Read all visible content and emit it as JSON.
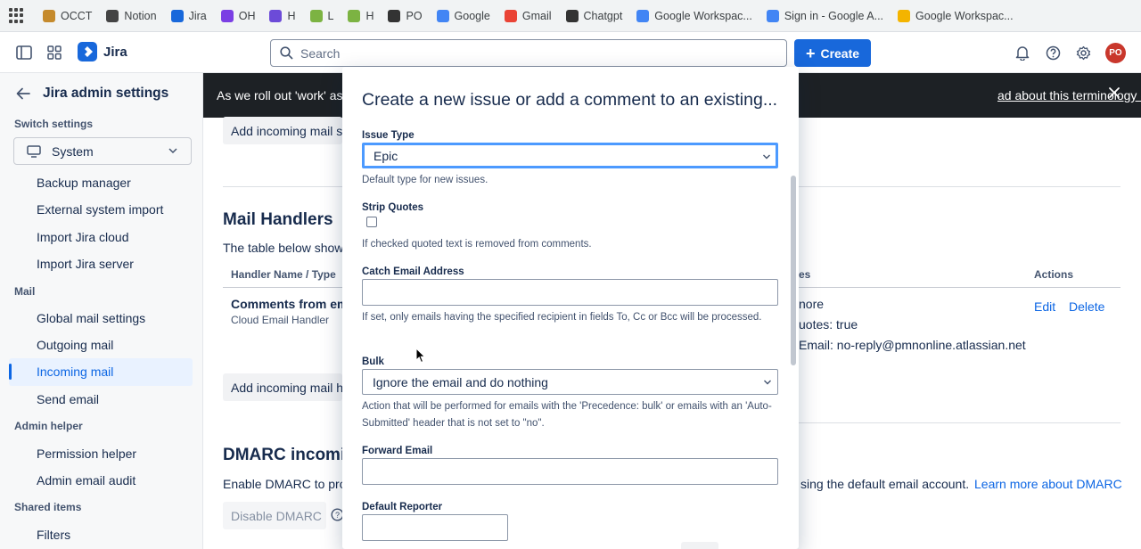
{
  "bookmarks": [
    {
      "label": "OCCT",
      "color": "#c58a2c"
    },
    {
      "label": "Notion",
      "color": "#444444"
    },
    {
      "label": "Jira",
      "color": "#1868db"
    },
    {
      "label": "OH",
      "color": "#7b3fe4"
    },
    {
      "label": "H",
      "color": "#6c4bd8"
    },
    {
      "label": "L",
      "color": "#7cb342"
    },
    {
      "label": "H",
      "color": "#7cb342"
    },
    {
      "label": "PO",
      "color": "#333333"
    },
    {
      "label": "Google",
      "color": "#4285f4"
    },
    {
      "label": "Gmail",
      "color": "#ea4335"
    },
    {
      "label": "Chatgpt",
      "color": "#333333"
    },
    {
      "label": "Google Workspac...",
      "color": "#4285f4"
    },
    {
      "label": "Sign in - Google A...",
      "color": "#4285f4"
    },
    {
      "label": "Google Workspac...",
      "color": "#f4b400"
    }
  ],
  "topnav": {
    "product": "Jira",
    "search_placeholder": "Search",
    "create_label": "Create",
    "avatar_initials": "PO"
  },
  "sidebar": {
    "title": "Jira admin settings",
    "switch_label": "Switch settings",
    "switch_value": "System",
    "groups": {
      "top": [
        "Backup manager",
        "External system import",
        "Import Jira cloud",
        "Import Jira server"
      ],
      "mail_header": "Mail",
      "mail": [
        "Global mail settings",
        "Outgoing mail",
        "Incoming mail",
        "Send email"
      ],
      "admin_header": "Admin helper",
      "admin": [
        "Permission helper",
        "Admin email audit"
      ],
      "shared_header": "Shared items",
      "shared": [
        "Filters"
      ]
    }
  },
  "banner": {
    "text": "As we roll out 'work' as",
    "link": "ad about this terminology change"
  },
  "main": {
    "add_incoming_top": "Add incoming mail s",
    "mail_handlers_title": "Mail Handlers",
    "table_intro": "The table below show",
    "col_handler": "Handler Name / Type",
    "col_details": "es",
    "col_actions": "Actions",
    "row_name": "Comments from em",
    "row_type": "Cloud Email Handler",
    "row_detail_1": "nore",
    "row_detail_2": "uotes: true",
    "row_detail_3": "Email: no-reply@pmnonline.atlassian.net",
    "edit": "Edit",
    "delete": "Delete",
    "add_incoming_bottom": "Add incoming mail h",
    "dmarc_title": "DMARC incomi",
    "dmarc_text_left": "Enable DMARC to pro",
    "dmarc_text_right": "sing the default email account.",
    "dmarc_link": "Learn more about DMARC",
    "disable_dmarc": "Disable DMARC"
  },
  "modal": {
    "title": "Create a new issue or add a comment to an existing...",
    "issue_type_label": "Issue Type",
    "issue_type_value": "Epic",
    "issue_type_help": "Default type for new issues.",
    "strip_quotes_label": "Strip Quotes",
    "strip_quotes_help": "If checked quoted text is removed from comments.",
    "catch_email_label": "Catch Email Address",
    "catch_email_value": "",
    "catch_email_help": "If set, only emails having the specified recipient in fields To, Cc or Bcc will be processed.",
    "bulk_label": "Bulk",
    "bulk_value": "Ignore the email and do nothing",
    "bulk_help": "Action that will be performed for emails with the 'Precedence: bulk' or emails with an 'Auto-Submitted' header that is not set to \"no\".",
    "forward_email_label": "Forward Email",
    "forward_email_value": "",
    "default_reporter_label": "Default Reporter"
  }
}
